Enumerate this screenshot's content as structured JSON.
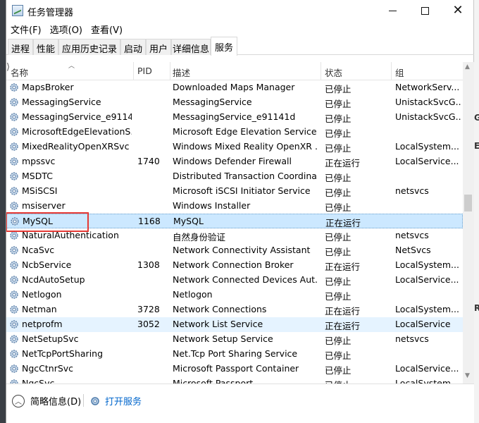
{
  "window": {
    "title": "任务管理器",
    "icons": {
      "app": "task-manager-icon",
      "minimize": "minimize-icon",
      "maximize": "maximize-icon",
      "close": "close-icon"
    }
  },
  "menu": [
    "文件(F)",
    "选项(O)",
    "查看(V)"
  ],
  "tabs": [
    "进程",
    "性能",
    "应用历史记录",
    "启动",
    "用户",
    "详细信息",
    "服务"
  ],
  "active_tab": "服务",
  "columns": {
    "name": "名称",
    "pid": "PID",
    "description": "描述",
    "status": "状态",
    "group": "组"
  },
  "services": [
    {
      "name": "MapsBroker",
      "pid": "",
      "description": "Downloaded Maps Manager",
      "status": "已停止",
      "group": "NetworkServ..."
    },
    {
      "name": "MessagingService",
      "pid": "",
      "description": "MessagingService",
      "status": "已停止",
      "group": "UnistackSvcG..."
    },
    {
      "name": "MessagingService_e9114...",
      "pid": "",
      "description": "MessagingService_e91141d",
      "status": "已停止",
      "group": "UnistackSvcG..."
    },
    {
      "name": "MicrosoftEdgeElevationS...",
      "pid": "",
      "description": "Microsoft Edge Elevation Service",
      "status": "已停止",
      "group": ""
    },
    {
      "name": "MixedRealityOpenXRSvc",
      "pid": "",
      "description": "Windows Mixed Reality OpenXR ...",
      "status": "已停止",
      "group": "LocalSystem..."
    },
    {
      "name": "mpssvc",
      "pid": "1740",
      "description": "Windows Defender Firewall",
      "status": "正在运行",
      "group": "LocalService..."
    },
    {
      "name": "MSDTC",
      "pid": "",
      "description": "Distributed Transaction Coordina...",
      "status": "已停止",
      "group": ""
    },
    {
      "name": "MSiSCSI",
      "pid": "",
      "description": "Microsoft iSCSI Initiator Service",
      "status": "已停止",
      "group": "netsvcs"
    },
    {
      "name": "msiserver",
      "pid": "",
      "description": "Windows Installer",
      "status": "已停止",
      "group": ""
    },
    {
      "name": "MySQL",
      "pid": "1168",
      "description": "MySQL",
      "status": "正在运行",
      "group": ""
    },
    {
      "name": "NaturalAuthentication",
      "pid": "",
      "description": "自然身份验证",
      "status": "已停止",
      "group": "netsvcs"
    },
    {
      "name": "NcaSvc",
      "pid": "",
      "description": "Network Connectivity Assistant",
      "status": "已停止",
      "group": "NetSvcs"
    },
    {
      "name": "NcbService",
      "pid": "1308",
      "description": "Network Connection Broker",
      "status": "正在运行",
      "group": "LocalSystem..."
    },
    {
      "name": "NcdAutoSetup",
      "pid": "",
      "description": "Network Connected Devices Aut...",
      "status": "已停止",
      "group": "LocalService..."
    },
    {
      "name": "Netlogon",
      "pid": "",
      "description": "Netlogon",
      "status": "已停止",
      "group": ""
    },
    {
      "name": "Netman",
      "pid": "3728",
      "description": "Network Connections",
      "status": "正在运行",
      "group": "LocalSystem..."
    },
    {
      "name": "netprofm",
      "pid": "3052",
      "description": "Network List Service",
      "status": "正在运行",
      "group": "LocalService"
    },
    {
      "name": "NetSetupSvc",
      "pid": "",
      "description": "Network Setup Service",
      "status": "已停止",
      "group": "netsvcs"
    },
    {
      "name": "NetTcpPortSharing",
      "pid": "",
      "description": "Net.Tcp Port Sharing Service",
      "status": "已停止",
      "group": ""
    },
    {
      "name": "NgcCtnrSvc",
      "pid": "",
      "description": "Microsoft Passport Container",
      "status": "已停止",
      "group": "LocalService..."
    },
    {
      "name": "NgcSvc",
      "pid": "",
      "description": "Microsoft Passport",
      "status": "已停止",
      "group": "LocalSystem..."
    }
  ],
  "selected_service": "MySQL",
  "hover_service": "netprofm",
  "highlight_color": "#e53935",
  "footer": {
    "fewer_details": "简略信息(D)",
    "open_services": "打开服务"
  }
}
